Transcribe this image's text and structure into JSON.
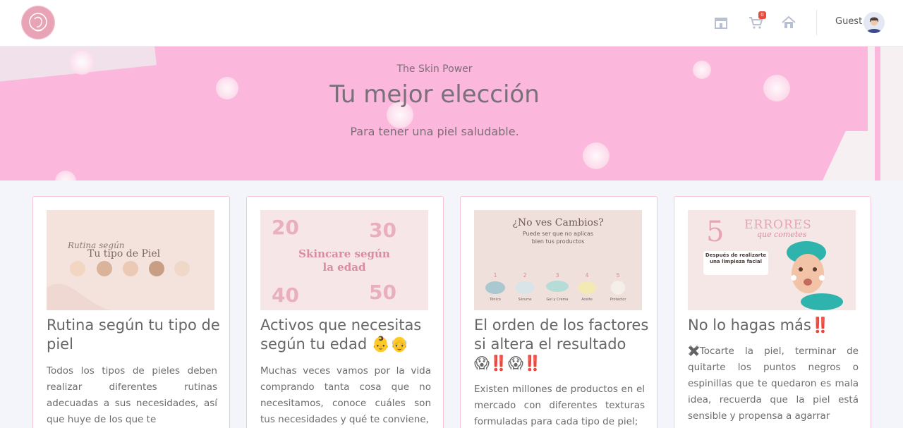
{
  "header": {
    "user_label": "Guest",
    "cart_count": "0",
    "icons": [
      "store-icon",
      "cart-icon",
      "home-icon"
    ]
  },
  "hero": {
    "subtitle": "The Skin Power",
    "title": "Tu mejor elección",
    "tagline": "Para tener una piel saludable."
  },
  "cards": [
    {
      "title": "Rutina según tu tipo de piel",
      "text": "Todos los tipos de pieles deben realizar diferentes rutinas adecuadas a sus necesidades, así que huye de los que te",
      "image_text": [
        "Rutina según",
        "Tu tipo de Piel"
      ]
    },
    {
      "title": "Activos que necesitas según tu edad 👶👴",
      "text": "Muchas veces vamos por la vida comprando tanta cosa que no necesitamos, conoce cuáles son tus necesidades y qué te conviene,",
      "image_text": [
        "20",
        "30",
        "Skincare según",
        "la edad",
        "40",
        "50"
      ]
    },
    {
      "title": "El orden de los factores si altera el resultado 😱‼️😱‼️",
      "text": "Existen millones de productos en el mercado con diferentes texturas formuladas para cada tipo de piel;",
      "image_text": [
        "¿No ves Cambios?",
        "Puede ser que no aplicas",
        "bien tus productos",
        "1",
        "2",
        "3",
        "4",
        "5",
        "Tónico",
        "Sérums",
        "Gel y Crema",
        "Aceite",
        "Protector"
      ]
    },
    {
      "title": "No lo hagas más‼️",
      "text": "✖️Tocarte la piel, terminar de quitarte los puntos negros o espinillas que te quedaron es mala idea, recuerda que la piel está sensible y propensa a agarrar",
      "image_text": [
        "5",
        "ERRORES",
        "que cometes",
        "Después de realizarte una limpieza facial"
      ]
    }
  ],
  "colors": {
    "hero_bg": "#fcb7dc",
    "card_border": "#f7c6d6",
    "badge": "#e74c3c",
    "page_bg": "#f4f5fb"
  }
}
